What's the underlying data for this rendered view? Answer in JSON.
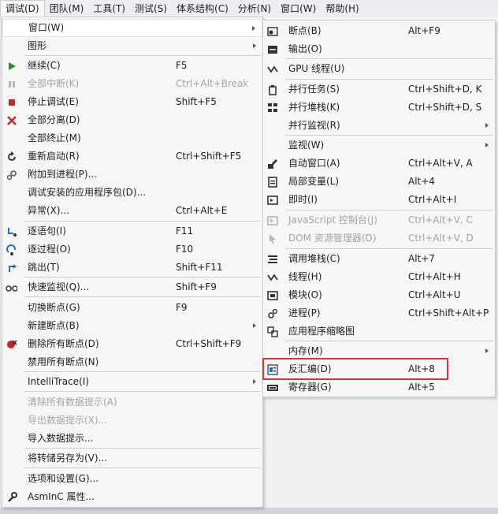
{
  "menubar": {
    "items": [
      "调试(D)",
      "团队(M)",
      "工具(T)",
      "测试(S)",
      "体系结构(C)",
      "分析(N)",
      "窗口(W)",
      "帮助(H)"
    ]
  },
  "debug_menu": {
    "items": [
      {
        "label": "窗口(W)",
        "shortcut": "",
        "submenu": true,
        "icon": "none",
        "disabled": false,
        "hover": true
      },
      {
        "label": "图形",
        "shortcut": "",
        "submenu": true,
        "icon": "none",
        "disabled": false
      },
      {
        "label": "继续(C)",
        "shortcut": "F5",
        "icon": "play-icon",
        "disabled": false
      },
      {
        "label": "全部中断(K)",
        "shortcut": "Ctrl+Alt+Break",
        "icon": "pause-icon",
        "disabled": true
      },
      {
        "label": "停止调试(E)",
        "shortcut": "Shift+F5",
        "icon": "stop-icon",
        "disabled": false
      },
      {
        "label": "全部分离(D)",
        "shortcut": "",
        "icon": "detach-icon",
        "disabled": false
      },
      {
        "label": "全部终止(M)",
        "shortcut": "",
        "icon": "none",
        "disabled": false
      },
      {
        "label": "重新启动(R)",
        "shortcut": "Ctrl+Shift+F5",
        "icon": "restart-icon",
        "disabled": false
      },
      {
        "label": "附加到进程(P)...",
        "shortcut": "",
        "icon": "attach-icon",
        "disabled": false
      },
      {
        "label": "调试安装的应用程序包(D)...",
        "shortcut": "",
        "icon": "none",
        "disabled": false
      },
      {
        "label": "异常(X)...",
        "shortcut": "Ctrl+Alt+E",
        "icon": "none",
        "disabled": false
      },
      {
        "label": "逐语句(I)",
        "shortcut": "F11",
        "icon": "step-into-icon",
        "disabled": false
      },
      {
        "label": "逐过程(O)",
        "shortcut": "F10",
        "icon": "step-over-icon",
        "disabled": false
      },
      {
        "label": "跳出(T)",
        "shortcut": "Shift+F11",
        "icon": "step-out-icon",
        "disabled": false
      },
      {
        "label": "快速监视(Q)...",
        "shortcut": "Shift+F9",
        "icon": "quickwatch-icon",
        "disabled": false
      },
      {
        "label": "切换断点(G)",
        "shortcut": "F9",
        "icon": "none",
        "disabled": false
      },
      {
        "label": "新建断点(B)",
        "shortcut": "",
        "submenu": true,
        "icon": "none",
        "disabled": false
      },
      {
        "label": "删除所有断点(D)",
        "shortcut": "Ctrl+Shift+F9",
        "icon": "delete-breakpoints-icon",
        "disabled": false
      },
      {
        "label": "禁用所有断点(N)",
        "shortcut": "",
        "icon": "none",
        "disabled": false
      },
      {
        "label": "IntelliTrace(I)",
        "shortcut": "",
        "submenu": true,
        "icon": "none",
        "disabled": false
      },
      {
        "label": "清除所有数据提示(A)",
        "shortcut": "",
        "icon": "none",
        "disabled": true
      },
      {
        "label": "导出数据提示(X)...",
        "shortcut": "",
        "icon": "none",
        "disabled": true
      },
      {
        "label": "导入数据提示...",
        "shortcut": "",
        "icon": "none",
        "disabled": false
      },
      {
        "label": "将转储另存为(V)...",
        "shortcut": "",
        "icon": "none",
        "disabled": false
      },
      {
        "label": "选项和设置(G)...",
        "shortcut": "",
        "icon": "none",
        "disabled": false
      },
      {
        "label": "AsmInC 属性...",
        "shortcut": "",
        "icon": "wrench-icon",
        "disabled": false
      }
    ]
  },
  "windows_submenu": {
    "items": [
      {
        "label": "断点(B)",
        "shortcut": "Alt+F9",
        "icon": "breakpoints-window-icon",
        "disabled": false
      },
      {
        "label": "输出(O)",
        "shortcut": "",
        "icon": "output-icon",
        "disabled": false
      },
      {
        "label": "GPU 线程(U)",
        "shortcut": "",
        "icon": "gpu-threads-icon",
        "disabled": false
      },
      {
        "label": "并行任务(S)",
        "shortcut": "Ctrl+Shift+D, K",
        "icon": "parallel-tasks-icon",
        "disabled": false
      },
      {
        "label": "并行堆栈(K)",
        "shortcut": "Ctrl+Shift+D, S",
        "icon": "parallel-stacks-icon",
        "disabled": false
      },
      {
        "label": "并行监视(R)",
        "shortcut": "",
        "submenu": true,
        "icon": "none",
        "disabled": false
      },
      {
        "label": "监视(W)",
        "shortcut": "",
        "submenu": true,
        "icon": "none",
        "disabled": false
      },
      {
        "label": "自动窗口(A)",
        "shortcut": "Ctrl+Alt+V, A",
        "icon": "autos-icon",
        "disabled": false
      },
      {
        "label": "局部变量(L)",
        "shortcut": "Alt+4",
        "icon": "locals-icon",
        "disabled": false
      },
      {
        "label": "即时(I)",
        "shortcut": "Ctrl+Alt+I",
        "icon": "immediate-icon",
        "disabled": false
      },
      {
        "label": "JavaScript 控制台(J)",
        "shortcut": "Ctrl+Alt+V, C",
        "icon": "js-console-icon",
        "disabled": true
      },
      {
        "label": "DOM 资源管理器(D)",
        "shortcut": "Ctrl+Alt+V, D",
        "icon": "dom-explorer-icon",
        "disabled": true
      },
      {
        "label": "调用堆栈(C)",
        "shortcut": "Alt+7",
        "icon": "call-stack-icon",
        "disabled": false
      },
      {
        "label": "线程(H)",
        "shortcut": "Ctrl+Alt+H",
        "icon": "threads-icon",
        "disabled": false
      },
      {
        "label": "模块(O)",
        "shortcut": "Ctrl+Alt+U",
        "icon": "modules-icon",
        "disabled": false
      },
      {
        "label": "进程(P)",
        "shortcut": "Ctrl+Shift+Alt+P",
        "icon": "processes-icon",
        "disabled": false
      },
      {
        "label": "应用程序缩略图",
        "shortcut": "",
        "icon": "app-thumbnail-icon",
        "disabled": false
      },
      {
        "label": "内存(M)",
        "shortcut": "",
        "submenu": true,
        "icon": "none",
        "disabled": false
      },
      {
        "label": "反汇编(D)",
        "shortcut": "Alt+8",
        "icon": "disassembly-icon",
        "disabled": false,
        "highlighted": true
      },
      {
        "label": "寄存器(G)",
        "shortcut": "Alt+5",
        "icon": "registers-icon",
        "disabled": false
      }
    ]
  },
  "colors": {
    "highlight_border": "#e0313a",
    "play_green": "#2e8b2e",
    "stop_red": "#c1272d",
    "icon_blue": "#1f6fc5",
    "disabled_text": "#a2a4a5"
  }
}
